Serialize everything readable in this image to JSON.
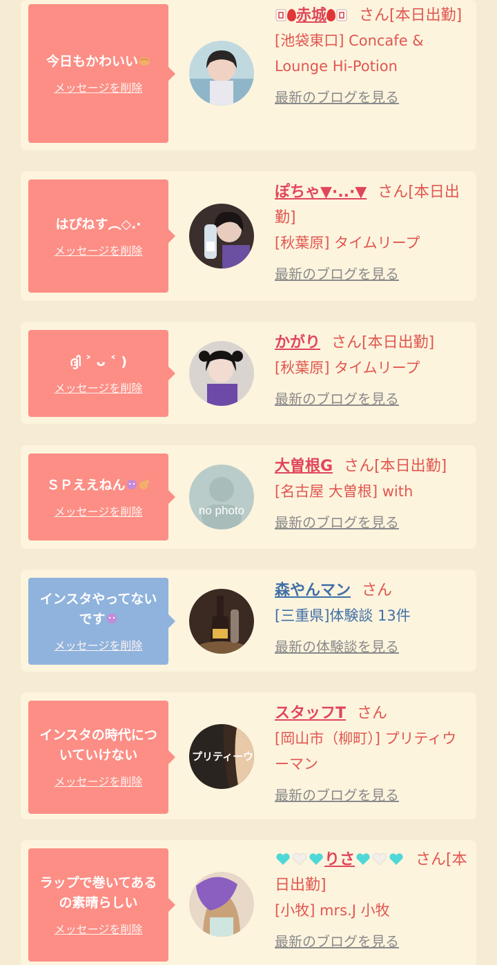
{
  "colors": {
    "page_bg": "#f6ecd4",
    "card_bg": "#fdf4de",
    "bubble_pink": "#fc8e85",
    "bubble_blue": "#8fb3dc",
    "name_red": "#e0465a",
    "name_blue": "#3f6fa6",
    "link_gray": "#8a8a8a"
  },
  "cards": [
    {
      "bubble_message": "今日もかわいい",
      "delete_label": "メッセージを削除",
      "name": "赤城",
      "san_label": "さん",
      "status": "[本日出勤]",
      "shop": "[池袋東口] Concafe & Lounge Hi-Potion",
      "more_link": "最新のブログを見る",
      "avatar_icon": "photo-avatar"
    },
    {
      "bubble_message": "はぴねす︵◇.·",
      "delete_label": "メッセージを削除",
      "name": "ぽちゃ▼·..·▼",
      "san_label": "さん",
      "status": "[本日出勤]",
      "shop": "[秋葉原] タイムリープ",
      "more_link": "最新のブログを見る",
      "avatar_icon": "photo-avatar"
    },
    {
      "bubble_message": "ദ്ദി ˃ ᴗ ˂ )",
      "delete_label": "メッセージを削除",
      "name": "かがり",
      "san_label": "さん",
      "status": "[本日出勤]",
      "shop": "[秋葉原] タイムリープ",
      "more_link": "最新のブログを見る",
      "avatar_icon": "photo-avatar"
    },
    {
      "bubble_message": "ＳＰええねん",
      "delete_label": "メッセージを削除",
      "name": "大曽根G",
      "san_label": "さん",
      "status": "[本日出勤]",
      "shop": "[名古屋 大曽根] with",
      "more_link": "最新のブログを見る",
      "avatar_text": "no photo"
    },
    {
      "bubble_message": "インスタやってないです",
      "delete_label": "メッセージを削除",
      "name": "森やんマン",
      "san_label": "さん",
      "status": "",
      "shop": "[三重県]体験談 13件",
      "more_link": "最新の体験談を見る",
      "avatar_icon": "photo-avatar"
    },
    {
      "bubble_message": "インスタの時代についていけない",
      "delete_label": "メッセージを削除",
      "name": "スタッフT",
      "san_label": "さん",
      "status": "",
      "shop": "[岡山市（柳町）] プリティウーマン",
      "more_link": "最新のブログを見る",
      "avatar_text": "プリティーウーマ"
    },
    {
      "bubble_message": "ラップで巻いてあるの素晴らしい",
      "delete_label": "メッセージを削除",
      "name": "りさ",
      "san_label": "さん",
      "status": "[本日出勤]",
      "shop": "[小牧] mrs.J 小牧",
      "more_link": "最新のブログを見る",
      "avatar_icon": "photo-avatar"
    }
  ]
}
